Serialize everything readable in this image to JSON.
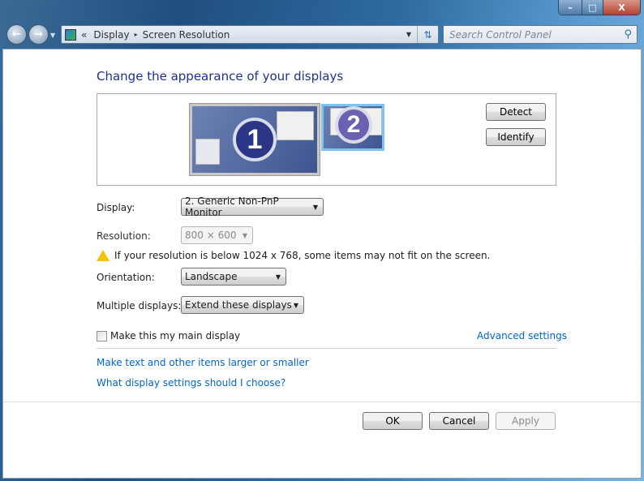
{
  "window": {
    "minimize": "–",
    "maximize": "□",
    "close": "X"
  },
  "nav": {
    "back_icon": "back-arrow",
    "forward_icon": "forward-arrow"
  },
  "address": {
    "overflow": "«",
    "crumbs": [
      "Display",
      "Screen Resolution"
    ],
    "separator": "▸"
  },
  "search": {
    "placeholder": "Search Control Panel"
  },
  "main": {
    "title": "Change the appearance of your displays",
    "monitors": [
      {
        "number": "1",
        "selected": false
      },
      {
        "number": "2",
        "selected": true
      }
    ],
    "detect_label": "Detect",
    "identify_label": "Identify",
    "display_label": "Display:",
    "display_value": "2. Generic Non-PnP Monitor",
    "resolution_label": "Resolution:",
    "resolution_value": "800 × 600",
    "warning": "If your resolution is below 1024 x 768, some items may not fit on the screen.",
    "orientation_label": "Orientation:",
    "orientation_value": "Landscape",
    "multiple_label": "Multiple displays:",
    "multiple_value": "Extend these displays",
    "main_display_label": "Make this my main display",
    "main_display_checked": false,
    "advanced_link": "Advanced settings",
    "link_text_size": "Make text and other items larger or smaller",
    "link_help": "What display settings should I choose?"
  },
  "footer": {
    "ok": "OK",
    "cancel": "Cancel",
    "apply": "Apply"
  }
}
